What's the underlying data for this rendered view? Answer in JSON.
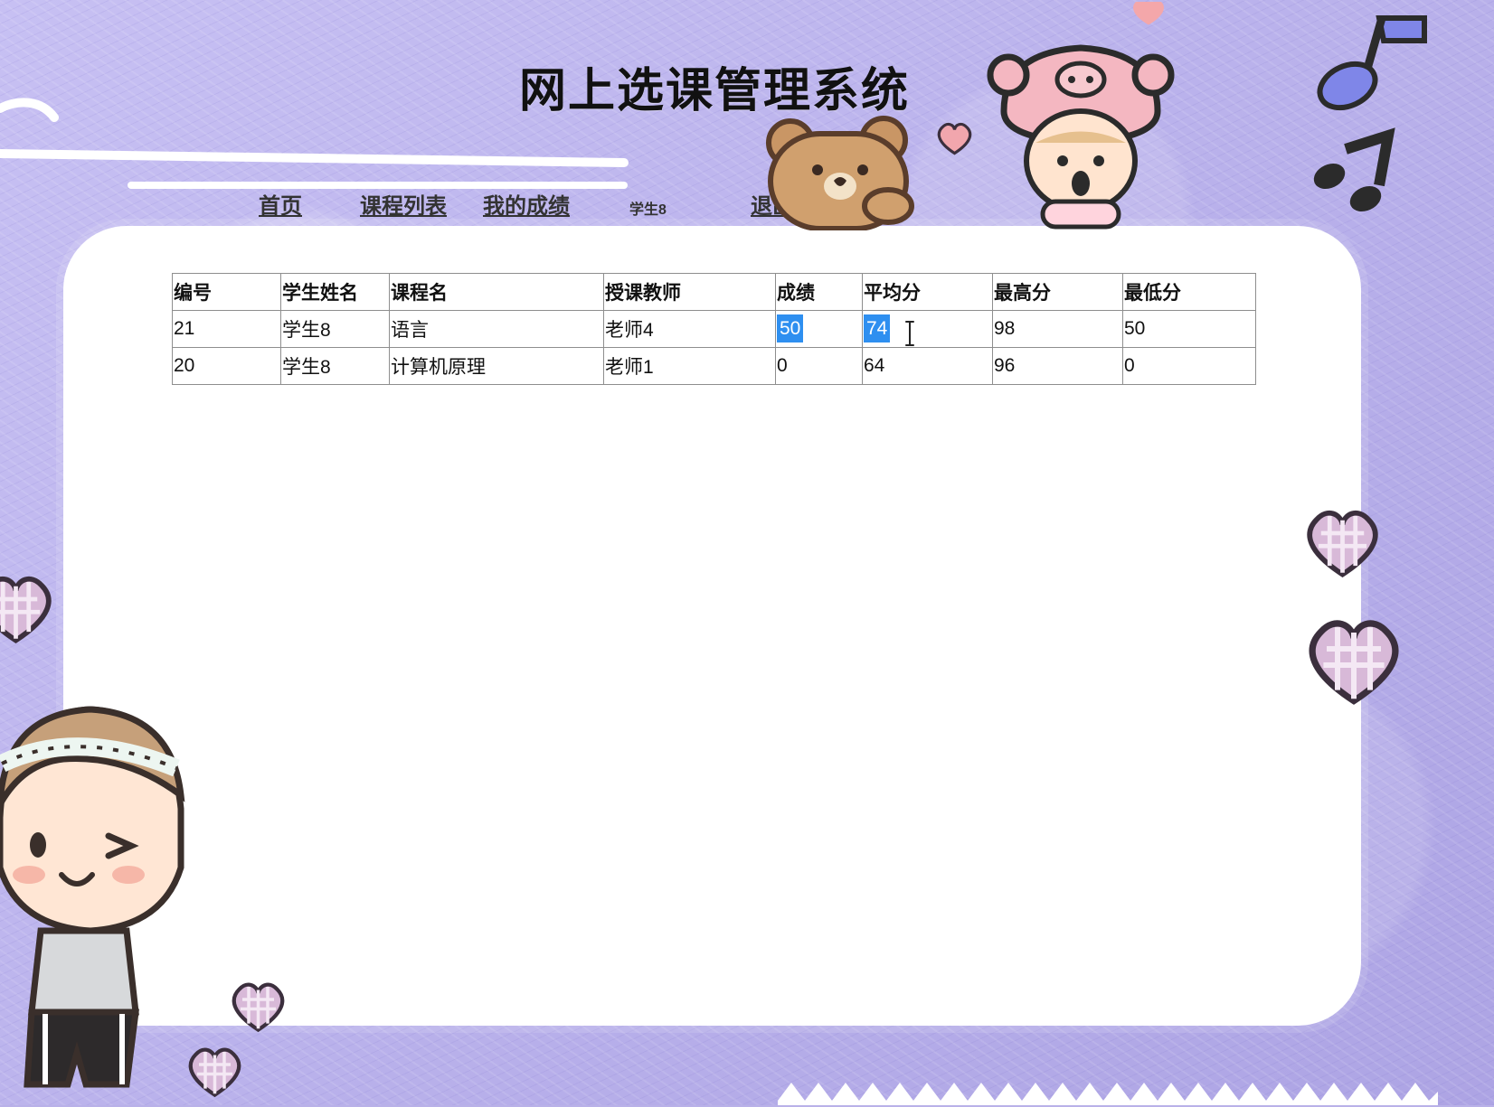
{
  "page": {
    "title": "网上选课管理系统"
  },
  "nav": {
    "home": "首页",
    "course_list": "课程列表",
    "my_grades": "我的成绩",
    "current_user": "学生8",
    "logout": "退出"
  },
  "table": {
    "headers": [
      "编号",
      "学生姓名",
      "课程名",
      "授课教师",
      "成绩",
      "平均分",
      "最高分",
      "最低分"
    ],
    "rows": [
      [
        "21",
        "学生8",
        "语言",
        "老师4",
        "50",
        "74",
        "98",
        "50"
      ],
      [
        "20",
        "学生8",
        "计算机原理",
        "老师1",
        "0",
        "64",
        "96",
        "0"
      ]
    ]
  },
  "colors": {
    "background": "#b9b1e8",
    "panel": "#ffffff",
    "selection": "#2e8ff0"
  },
  "icons": [
    "bear-icon",
    "girl-pig-hat-icon",
    "music-note-icon",
    "heart-icon",
    "girl-headband-icon"
  ]
}
